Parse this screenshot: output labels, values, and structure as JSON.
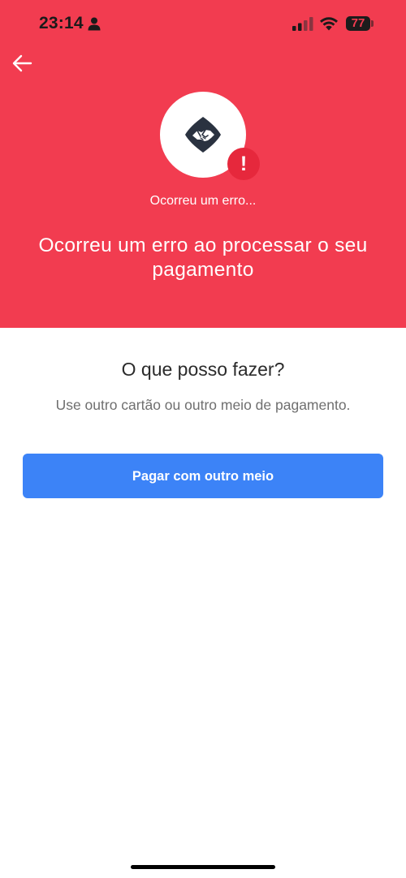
{
  "status_bar": {
    "time": "23:14",
    "battery_level": "77",
    "icons": [
      "person-icon",
      "signal-icon",
      "wifi-icon",
      "battery-icon"
    ]
  },
  "header": {
    "back_icon": "arrow-left-icon",
    "logo_icon": "handshake-logo-icon",
    "alert_icon": "exclamation-icon",
    "alert_symbol": "!",
    "caption": "Ocorreu um erro...",
    "title": "Ocorreu um erro ao processar o seu pagamento"
  },
  "help": {
    "heading": "O que posso fazer?",
    "text": "Use outro cartão ou outro meio de pagamento."
  },
  "actions": {
    "primary_label": "Pagar com outro meio"
  },
  "colors": {
    "header_background": "#f23c50",
    "alert_badge": "#e6283c",
    "primary_button": "#3c83f7",
    "logo_dark": "#2a3240"
  }
}
